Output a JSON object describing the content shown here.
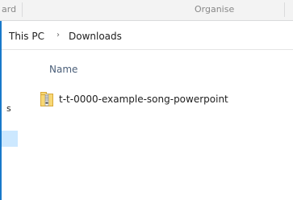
{
  "ribbon": {
    "tab_fragment": "ard",
    "group_label": "Organise"
  },
  "address": {
    "crumbs": [
      "This PC",
      "Downloads"
    ],
    "separator": "›"
  },
  "nav": {
    "fragment": "s"
  },
  "content": {
    "column_header": "Name",
    "files": [
      {
        "name": "t-t-0000-example-song-powerpoint",
        "icon": "zip-folder-icon"
      }
    ]
  },
  "colors": {
    "frame_accent": "#1979ca",
    "column_header": "#4c607a",
    "selected_nav": "#cce8ff"
  }
}
